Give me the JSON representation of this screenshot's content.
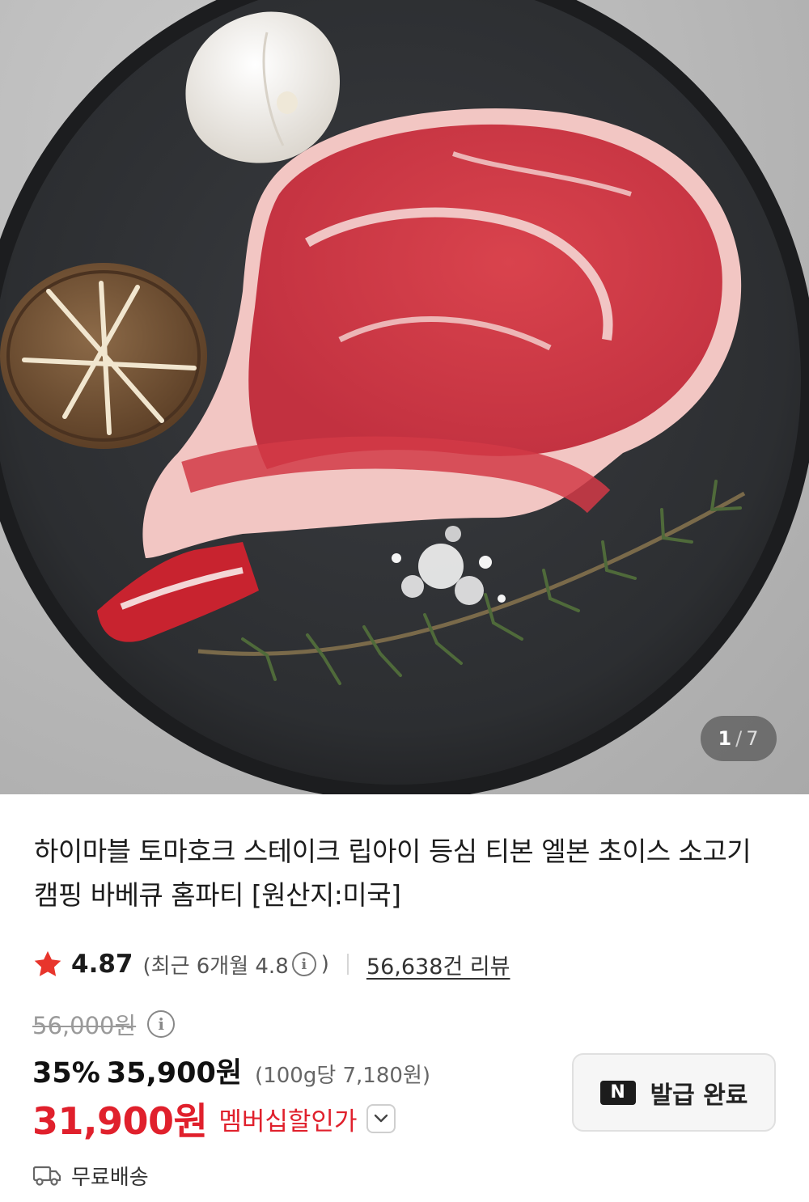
{
  "image_counter": {
    "current": "1",
    "separator": "/",
    "total": "7"
  },
  "product": {
    "title": "하이마블 토마호크 스테이크 립아이 등심 티본 엘본 초이스 소고기 캠핑 바베큐 홈파티 [원산지:미국]"
  },
  "rating": {
    "icon": "star-icon",
    "value": "4.87",
    "recent_prefix": "(최근 6개월 4.8",
    "recent_suffix": ")",
    "info_icon": "i",
    "review_count": "56,638건 리뷰"
  },
  "price": {
    "original": "56,000원",
    "discount_rate": "35%",
    "sale_price": "35,900원",
    "unit_price": "(100g당 7,180원)",
    "member_price": "31,900원",
    "member_label": "멤버십할인가"
  },
  "coupon": {
    "badge": "N",
    "label": "발급 완료"
  },
  "shipping": {
    "icon": "truck-icon",
    "label": "무료배송"
  },
  "colors": {
    "accent_red": "#e0202c",
    "star": "#e8352c"
  }
}
